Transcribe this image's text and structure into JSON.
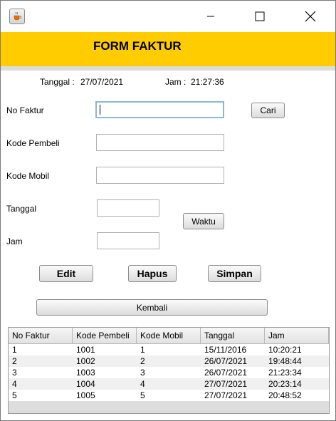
{
  "window": {
    "icon": "java-cup-icon",
    "controls": {
      "minimize": "minimize-icon",
      "maximize": "maximize-icon",
      "close": "close-icon"
    }
  },
  "header": {
    "title": "FORM FAKTUR",
    "color": "#ffcc00"
  },
  "info": {
    "tanggal_label": "Tanggal :",
    "tanggal_value": "27/07/2021",
    "jam_label": "Jam :",
    "jam_value": "21:27:36"
  },
  "form": {
    "no_faktur_label": "No Faktur",
    "no_faktur_value": "",
    "kode_pembeli_label": "Kode Pembeli",
    "kode_pembeli_value": "",
    "kode_mobil_label": "Kode Mobil",
    "kode_mobil_value": "",
    "tanggal_label": "Tanggal",
    "tanggal_value": "",
    "jam_label": "Jam",
    "jam_value": ""
  },
  "buttons": {
    "cari": "Cari",
    "waktu": "Waktu",
    "edit": "Edit",
    "hapus": "Hapus",
    "simpan": "Simpan",
    "kembali": "Kembali"
  },
  "table": {
    "headers": [
      "No Faktur",
      "Kode Pembeli",
      "Kode Mobil",
      "Tanggal",
      "Jam"
    ],
    "rows": [
      [
        "1",
        "1001",
        "1",
        "15/11/2016",
        "10:20:21"
      ],
      [
        "2",
        "1002",
        "2",
        "26/07/2021",
        "19:48:44"
      ],
      [
        "3",
        "1003",
        "3",
        "26/07/2021",
        "21:23:34"
      ],
      [
        "4",
        "1004",
        "4",
        "27/07/2021",
        "20:23:14"
      ],
      [
        "5",
        "1005",
        "5",
        "27/07/2021",
        "20:48:52"
      ]
    ]
  }
}
